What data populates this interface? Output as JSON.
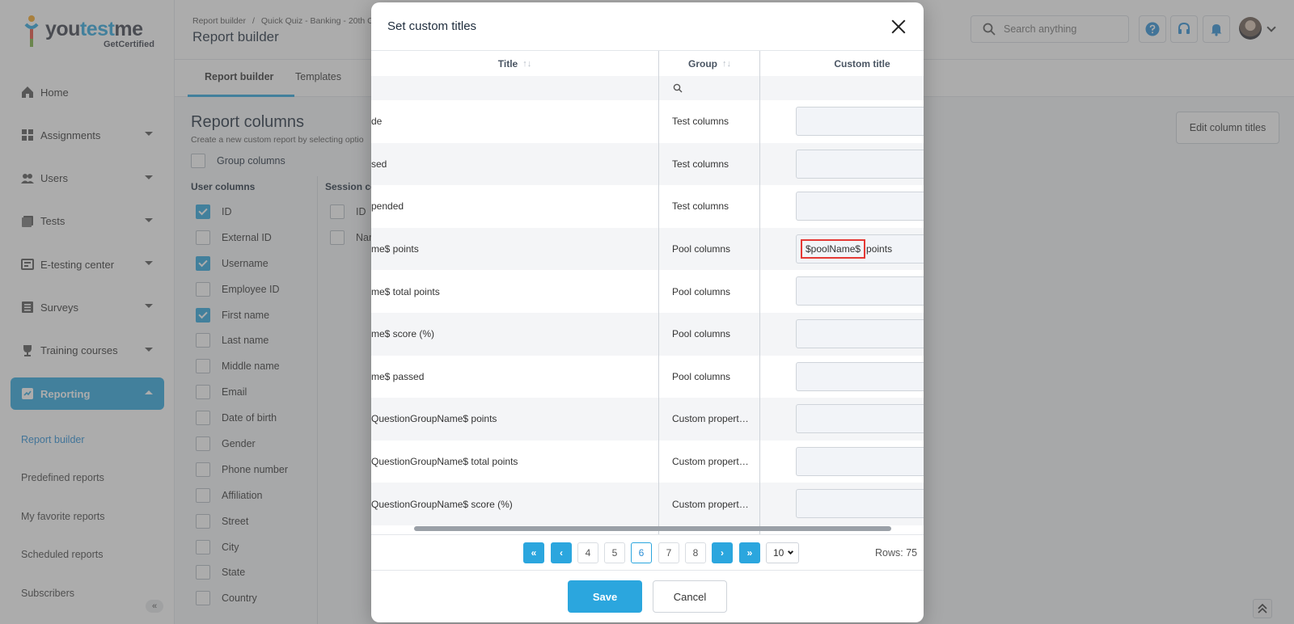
{
  "brand": {
    "name_part1": "you",
    "name_part2": "test",
    "name_part3": "me",
    "tagline": "GetCertified",
    "accent": "#2ba6de"
  },
  "sidebar": {
    "items": [
      {
        "label": "Home",
        "icon": "home-icon",
        "expandable": false
      },
      {
        "label": "Assignments",
        "icon": "assignments-icon",
        "expandable": true
      },
      {
        "label": "Users",
        "icon": "users-icon",
        "expandable": true
      },
      {
        "label": "Tests",
        "icon": "tests-icon",
        "expandable": true
      },
      {
        "label": "E-testing center",
        "icon": "e-testing-icon",
        "expandable": true
      },
      {
        "label": "Surveys",
        "icon": "surveys-icon",
        "expandable": true
      },
      {
        "label": "Training courses",
        "icon": "trophy-icon",
        "expandable": true
      },
      {
        "label": "Reporting",
        "icon": "reporting-icon",
        "expandable": true,
        "active": true
      }
    ],
    "subitems": [
      "Report builder",
      "Predefined reports",
      "My favorite reports",
      "Scheduled reports",
      "Subscribers"
    ],
    "active_subitem": "Report builder"
  },
  "header": {
    "breadcrumb": [
      "Report builder",
      "Quick Quiz - Banking - 20th C"
    ],
    "breadcrumb_sep": "/",
    "title": "Report builder",
    "search_placeholder": "Search anything"
  },
  "tabs": [
    "Report builder",
    "Templates"
  ],
  "main": {
    "section_title": "Report columns",
    "section_sub": "Create a new custom report by selecting optio",
    "group_columns_label": "Group columns",
    "edit_titles_label": "Edit column titles",
    "user_columns_heading": "User columns",
    "session_columns_heading": "Session co",
    "user_columns": [
      {
        "label": "ID",
        "checked": true
      },
      {
        "label": "External ID",
        "checked": false
      },
      {
        "label": "Username",
        "checked": true
      },
      {
        "label": "Employee ID",
        "checked": false
      },
      {
        "label": "First name",
        "checked": true
      },
      {
        "label": "Last name",
        "checked": false
      },
      {
        "label": "Middle name",
        "checked": false
      },
      {
        "label": "Email",
        "checked": false
      },
      {
        "label": "Date of birth",
        "checked": false
      },
      {
        "label": "Gender",
        "checked": false
      },
      {
        "label": "Phone number",
        "checked": false
      },
      {
        "label": "Affiliation",
        "checked": false
      },
      {
        "label": "Street",
        "checked": false
      },
      {
        "label": "City",
        "checked": false
      },
      {
        "label": "State",
        "checked": false
      },
      {
        "label": "Country",
        "checked": false
      }
    ],
    "session_columns": [
      {
        "label": "ID",
        "checked": false
      },
      {
        "label": "Nar",
        "checked": false
      }
    ]
  },
  "modal": {
    "title": "Set custom titles",
    "columns": {
      "title": "Title",
      "group": "Group",
      "custom_title": "Custom title"
    },
    "rows": [
      {
        "title": "de",
        "group": "Test columns",
        "custom": ""
      },
      {
        "title": "sed",
        "group": "Test columns",
        "custom": ""
      },
      {
        "title": "pended",
        "group": "Test columns",
        "custom": ""
      },
      {
        "title": "me$ points",
        "group": "Pool columns",
        "custom_highlight": "$poolName$",
        "custom_rest": "points"
      },
      {
        "title": "me$ total points",
        "group": "Pool columns",
        "custom": ""
      },
      {
        "title": "me$ score (%)",
        "group": "Pool columns",
        "custom": ""
      },
      {
        "title": "me$ passed",
        "group": "Pool columns",
        "custom": ""
      },
      {
        "title": "QuestionGroupName$ points",
        "group": "Custom propert…",
        "custom": ""
      },
      {
        "title": "QuestionGroupName$ total points",
        "group": "Custom propert…",
        "custom": ""
      },
      {
        "title": "QuestionGroupName$ score (%)",
        "group": "Custom propert…",
        "custom": ""
      }
    ],
    "pagination": {
      "pages": [
        "4",
        "5",
        "6",
        "7",
        "8"
      ],
      "current": "6",
      "page_size": "10",
      "rows_label": "Rows: 75"
    },
    "save_label": "Save",
    "cancel_label": "Cancel"
  }
}
